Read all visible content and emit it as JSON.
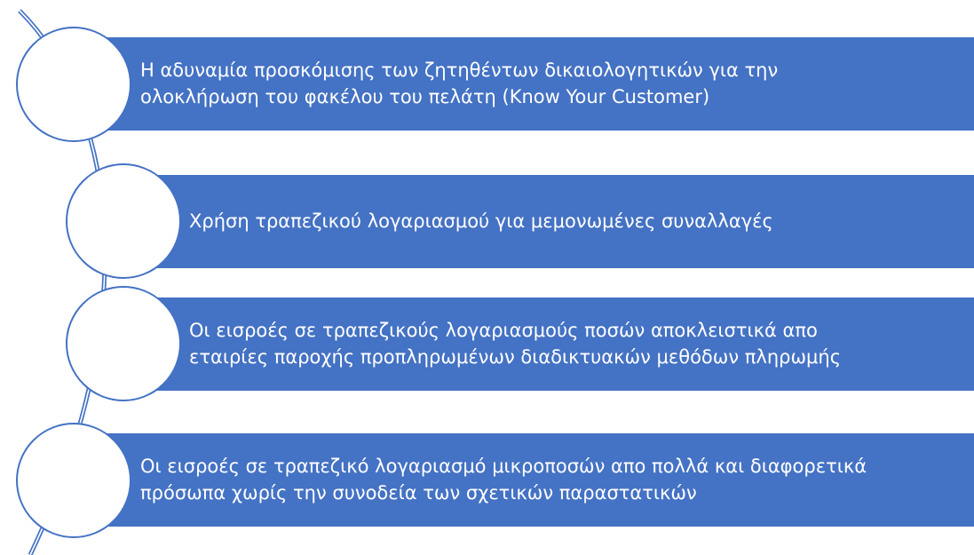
{
  "diagram": {
    "type": "vertical-circle-list",
    "colors": {
      "bar": "#4472c4",
      "bar_text": "#ffffff",
      "circle_fill": "#ffffff",
      "circle_border": "#4472c4",
      "connector": "#4472c4"
    },
    "items": [
      {
        "text": "Η αδυναμία προσκόμισης των ζητηθέντων δικαιολογητικών για την\nολοκλήρωση του φακέλου του πελάτη (Know Your Customer)"
      },
      {
        "text": "Χρήση τραπεζικού λογαριασμού για μεμονωμένες συναλλαγές"
      },
      {
        "text": "Οι εισροές σε τραπεζικούς λογαριασμούς ποσών αποκλειστικά απο\nεταιρίες παροχής προπληρωμένων διαδικτυακών μεθόδων πληρωμής"
      },
      {
        "text": "Οι εισροές σε τραπεζικό λογαριασμό μικροποσών απο πολλά και διαφορετικά\nπρόσωπα χωρίς την συνοδεία των σχετικών παραστατικών"
      }
    ]
  }
}
